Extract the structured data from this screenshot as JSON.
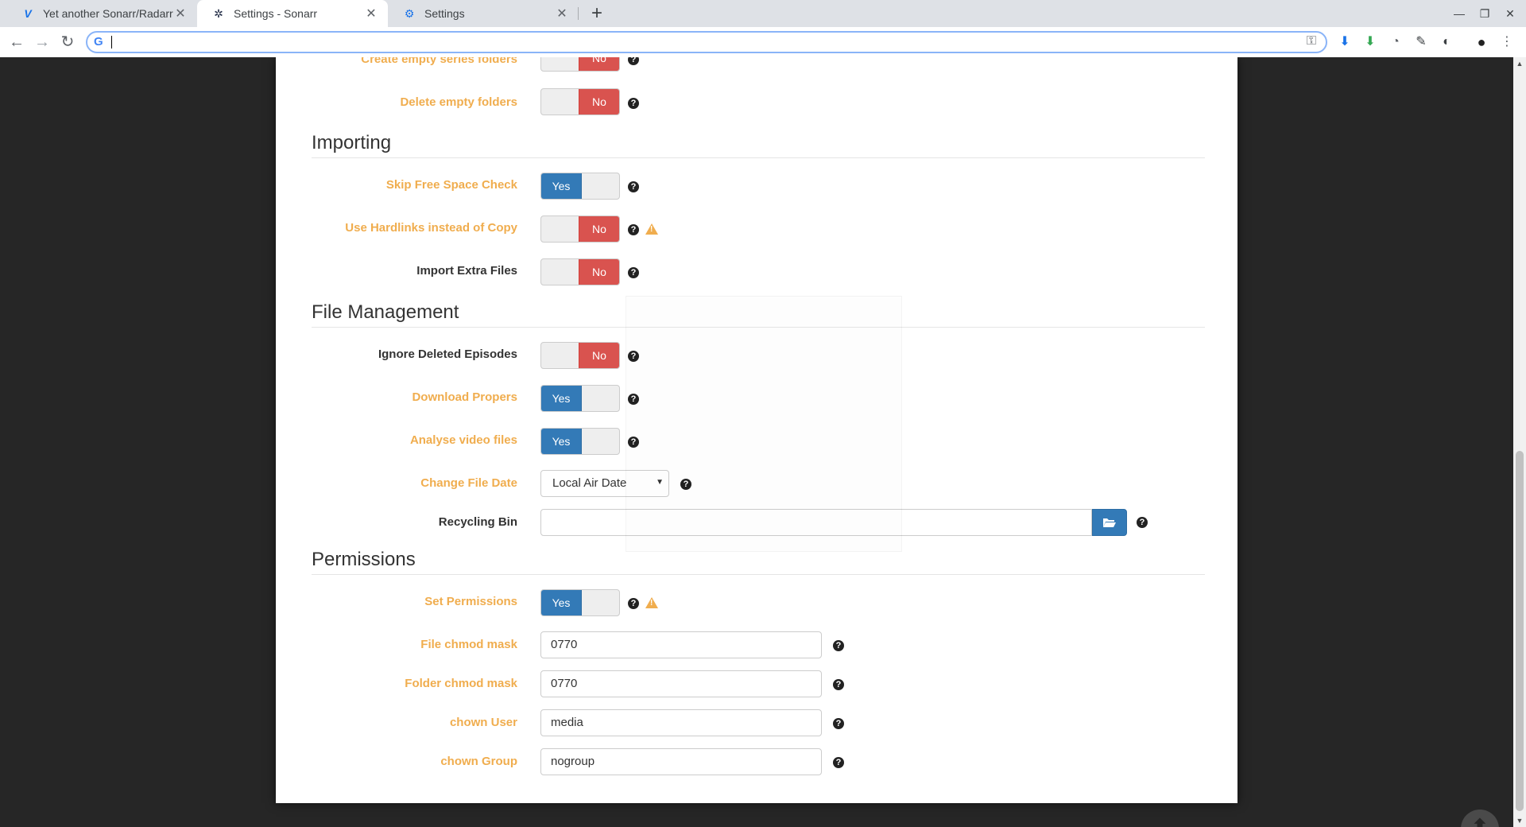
{
  "browser": {
    "tabs": [
      {
        "title": "Yet another Sonarr/Radarr pe",
        "icon": "vivaldi-icon"
      },
      {
        "title": "Settings - Sonarr",
        "icon": "sonarr-icon"
      },
      {
        "title": "Settings",
        "icon": "gear-icon"
      }
    ],
    "url": ""
  },
  "sections": {
    "importing": "Importing",
    "file_management": "File Management",
    "permissions": "Permissions"
  },
  "fields": {
    "create_empty_series_folders": {
      "label": "Create empty series folders",
      "value": "No"
    },
    "delete_empty_folders": {
      "label": "Delete empty folders",
      "value": "No"
    },
    "skip_free_space_check": {
      "label": "Skip Free Space Check",
      "value": "Yes"
    },
    "use_hardlinks": {
      "label": "Use Hardlinks instead of Copy",
      "value": "No"
    },
    "import_extra_files": {
      "label": "Import Extra Files",
      "value": "No"
    },
    "ignore_deleted_episodes": {
      "label": "Ignore Deleted Episodes",
      "value": "No"
    },
    "download_propers": {
      "label": "Download Propers",
      "value": "Yes"
    },
    "analyse_video_files": {
      "label": "Analyse video files",
      "value": "Yes"
    },
    "change_file_date": {
      "label": "Change File Date",
      "value": "Local Air Date"
    },
    "recycling_bin": {
      "label": "Recycling Bin",
      "value": ""
    },
    "set_permissions": {
      "label": "Set Permissions",
      "value": "Yes"
    },
    "file_chmod_mask": {
      "label": "File chmod mask",
      "value": "0770"
    },
    "folder_chmod_mask": {
      "label": "Folder chmod mask",
      "value": "0770"
    },
    "chown_user": {
      "label": "chown User",
      "value": "media"
    },
    "chown_group": {
      "label": "chown Group",
      "value": "nogroup"
    }
  },
  "colors": {
    "label_orange": "#f0ad4e",
    "toggle_yes": "#337ab7",
    "toggle_no": "#d9534f"
  }
}
